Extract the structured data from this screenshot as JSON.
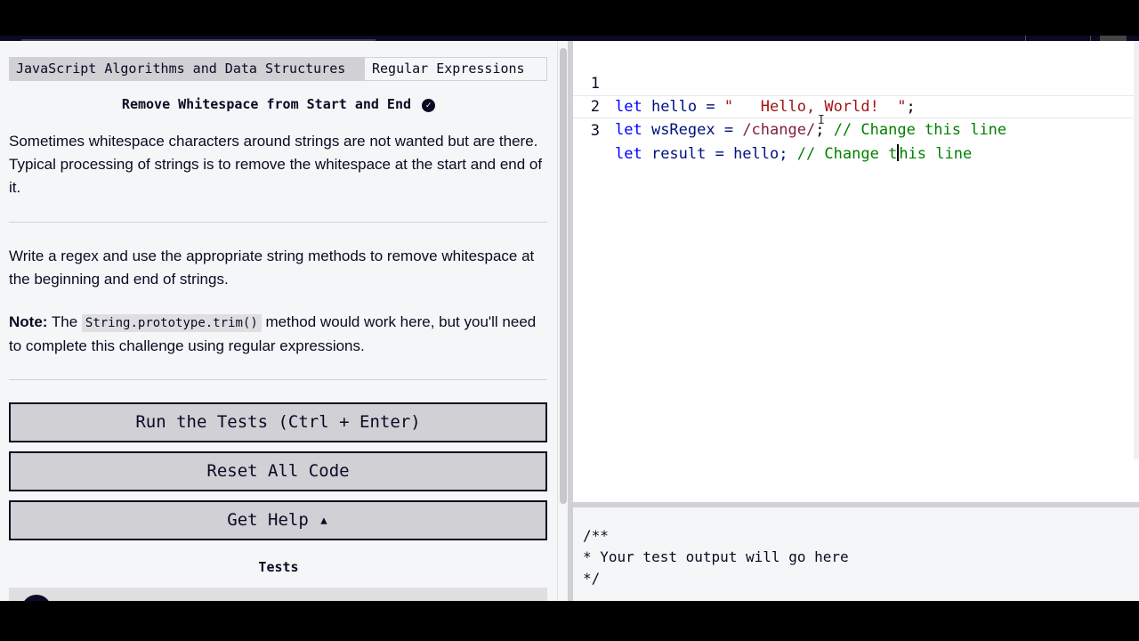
{
  "breadcrumb": {
    "course": "JavaScript Algorithms and Data Structures",
    "section": "Regular Expressions"
  },
  "challenge": {
    "title": "Remove Whitespace from Start and End",
    "completed_icon": "check-circle-icon",
    "intro": "Sometimes whitespace characters around strings are not wanted but are there. Typical processing of strings is to remove the whitespace at the start and end of it.",
    "instructions": "Write a regex and use the appropriate string methods to remove whitespace at the beginning and end of strings.",
    "note_label": "Note:",
    "note_pre": " The ",
    "note_code": "String.prototype.trim()",
    "note_post": " method would work here, but you'll need to complete this challenge using regular expressions."
  },
  "buttons": {
    "run": "Run the Tests (Ctrl + Enter)",
    "reset": "Reset All Code",
    "help": "Get Help ▴"
  },
  "tests_heading": "Tests",
  "editor": {
    "lines": [
      {
        "number": "1",
        "kw": "let",
        "a": " hello = ",
        "str": "\"   Hello, World!  \"",
        "b": ";"
      },
      {
        "number": "2",
        "kw": "let",
        "a": " wsRegex = ",
        "rx": "/change/",
        "b": "; ",
        "cm": "// Change this line"
      },
      {
        "number": "3",
        "kw": "let",
        "a": " result = hello; ",
        "cm_pre": "// Change t",
        "cm_post": "his line"
      }
    ]
  },
  "console": {
    "text": "/**\n* Your test output will go here\n*/"
  },
  "colors": {
    "ink": "#0a0a23",
    "button_bg": "#d0d0d5",
    "keyword": "#0000ff",
    "string": "#a31515",
    "comment": "#008000"
  }
}
